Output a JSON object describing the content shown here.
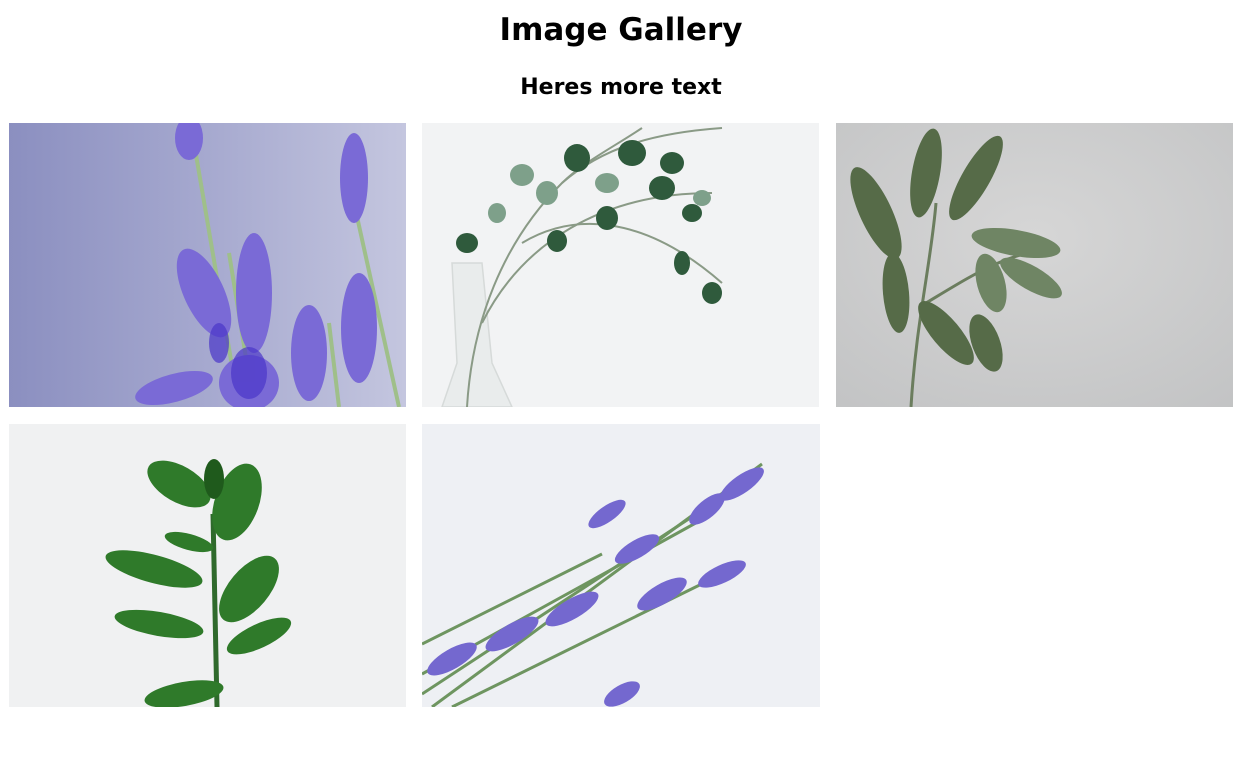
{
  "header": {
    "title": "Image Gallery",
    "subtitle": "Heres more text"
  },
  "gallery": {
    "images": [
      {
        "subject": "lavender-stems-close-up"
      },
      {
        "subject": "eucalyptus-branch-in-glass-vase"
      },
      {
        "subject": "sage-sprig-on-concrete"
      },
      {
        "subject": "ficus-plant-stem"
      },
      {
        "subject": "lavender-bundle-diagonal"
      }
    ]
  },
  "colors": {
    "background": "#ffffff",
    "text": "#000000",
    "lavender": "#7b6fd0",
    "leaf_green": "#3f6b3a",
    "sage_green": "#5f7552",
    "ficus_green": "#2f7a2a"
  }
}
